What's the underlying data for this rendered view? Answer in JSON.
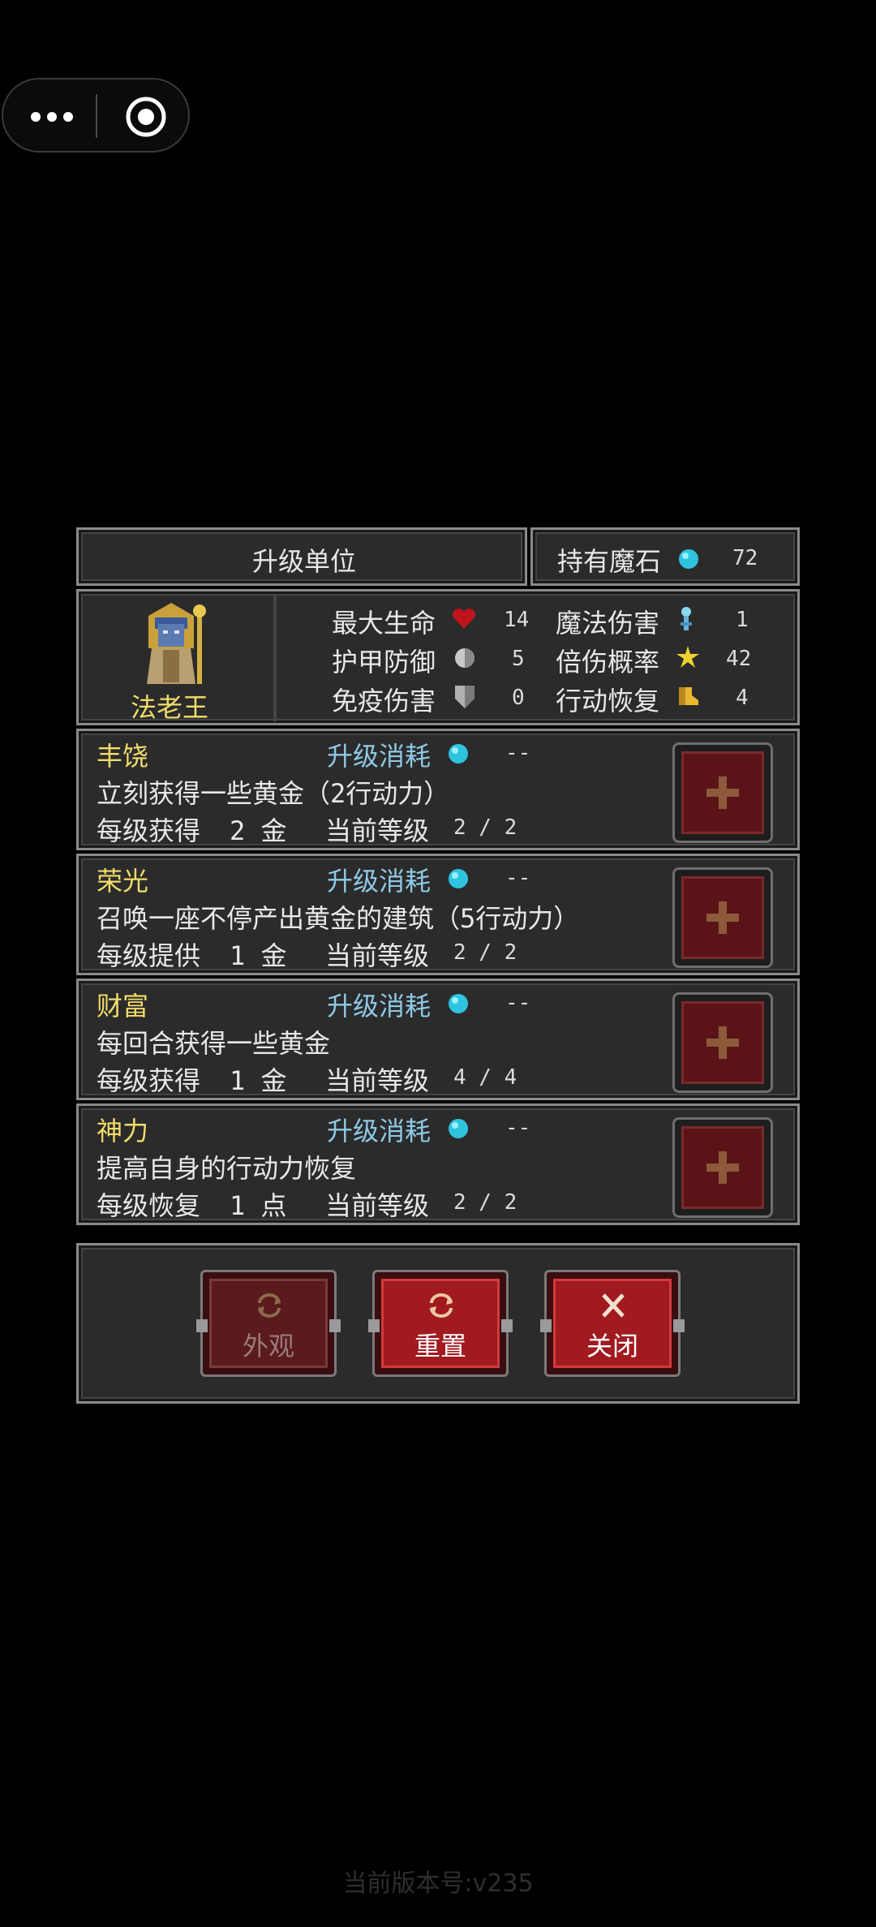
{
  "header": {
    "title": "升级单位",
    "stone_label": "持有魔石",
    "stone_count": "72"
  },
  "unit": {
    "name": "法老王",
    "stats": [
      {
        "label": "最大生命",
        "icon": "heart-icon",
        "value": "14"
      },
      {
        "label": "护甲防御",
        "icon": "armor-icon",
        "value": "5"
      },
      {
        "label": "免疫伤害",
        "icon": "shield-icon",
        "value": "0"
      },
      {
        "label": "魔法伤害",
        "icon": "staff-icon",
        "value": "1"
      },
      {
        "label": "倍伤概率",
        "icon": "star-icon",
        "value": "42"
      },
      {
        "label": "行动恢复",
        "icon": "boot-icon",
        "value": "4"
      }
    ]
  },
  "upgrades": [
    {
      "name": "丰饶",
      "cost_label": "升级消耗",
      "cost": "--",
      "desc": "立刻获得一些黄金（2行动力）",
      "per_label": "每级获得",
      "per_value": "2 金",
      "level_label": "当前等级",
      "level": "2 / 2"
    },
    {
      "name": "荣光",
      "cost_label": "升级消耗",
      "cost": "--",
      "desc": "召唤一座不停产出黄金的建筑（5行动力）",
      "per_label": "每级提供",
      "per_value": "1 金",
      "level_label": "当前等级",
      "level": "2 / 2"
    },
    {
      "name": "财富",
      "cost_label": "升级消耗",
      "cost": "--",
      "desc": "每回合获得一些黄金",
      "per_label": "每级获得",
      "per_value": "1 金",
      "level_label": "当前等级",
      "level": "4 / 4"
    },
    {
      "name": "神力",
      "cost_label": "升级消耗",
      "cost": "--",
      "desc": "提高自身的行动力恢复",
      "per_label": "每级恢复",
      "per_value": "1 点",
      "level_label": "当前等级",
      "level": "2 / 2"
    }
  ],
  "footer": {
    "appearance_label": "外观",
    "reset_label": "重置",
    "close_label": "关闭"
  },
  "version": "当前版本号:v235",
  "colors": {
    "accent_red": "#a01a20",
    "gem": "#2ec4e0",
    "name_yellow": "#f2dc6a",
    "cost_blue": "#8ec9e6"
  }
}
